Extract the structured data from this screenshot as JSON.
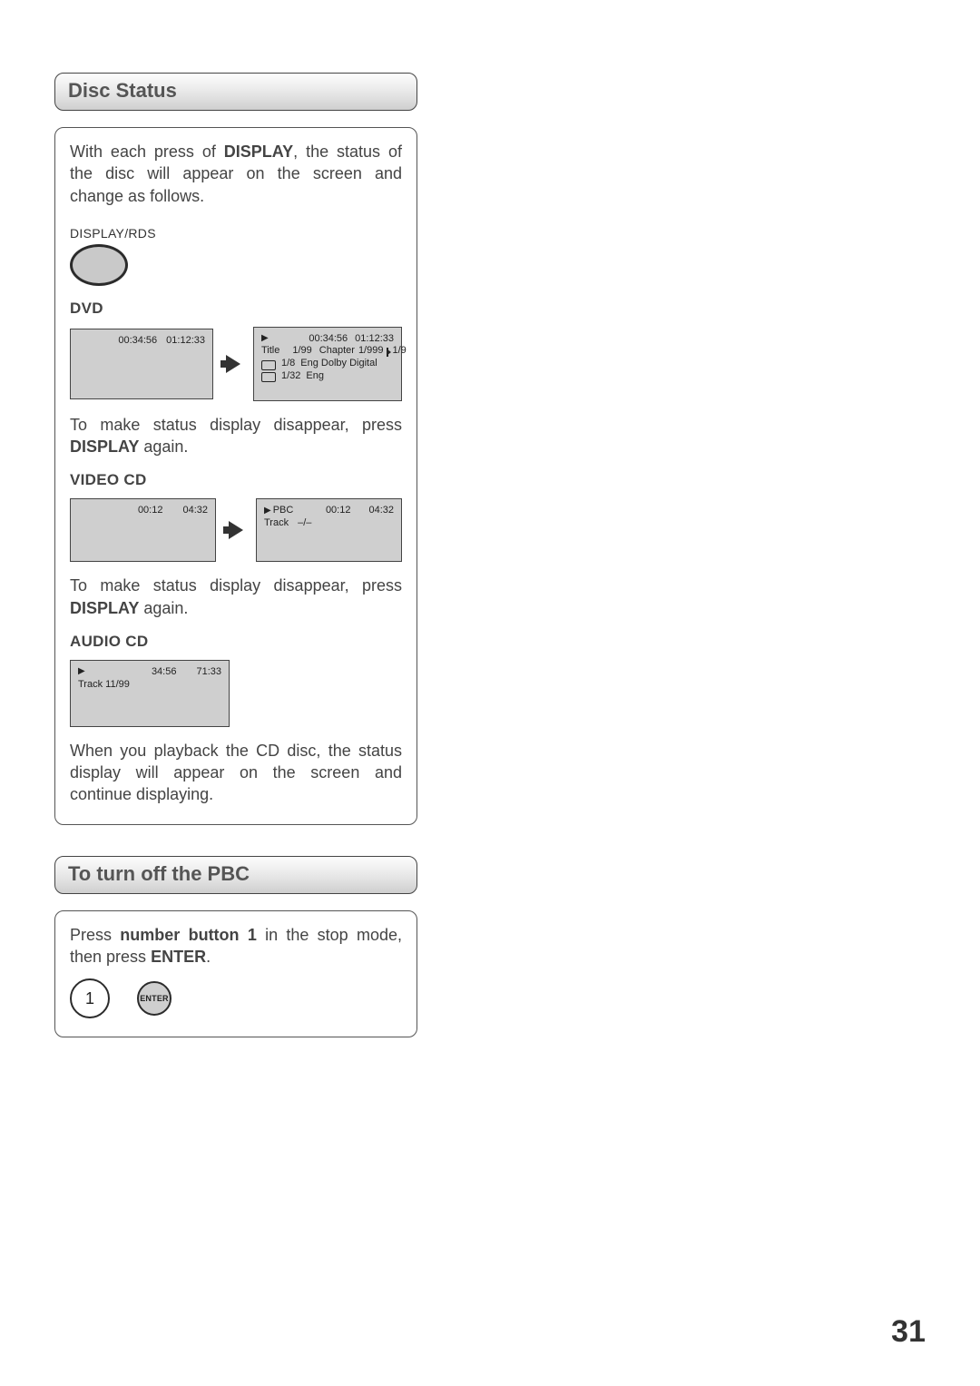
{
  "page_number": "31",
  "sections": {
    "disc_status": {
      "title": "Disc Status",
      "intro_pre": "With each press of ",
      "intro_bold": "DISPLAY",
      "intro_post": ", the status of the disc will appear on the screen and change as follows.",
      "button_label": "DISPLAY/RDS",
      "dvd": {
        "label": "DVD",
        "osd1": {
          "t1": "00:34:56",
          "t2": "01:12:33"
        },
        "osd2": {
          "t1": "00:34:56",
          "t2": "01:12:33",
          "title_label": "Title",
          "title_val": "1/99",
          "chapter_label": "Chapter",
          "chapter_val": "1/999",
          "angle_val": "1/9",
          "audio_val": "1/8",
          "audio_lang": "Eng Dolby Digital",
          "sub_val": "1/32",
          "sub_lang": "Eng"
        },
        "hint_pre": "To make status display disappear, press ",
        "hint_bold": "DISPLAY",
        "hint_post": " again."
      },
      "vcd": {
        "label": "VIDEO CD",
        "osd1": {
          "t1": "00:12",
          "t2": "04:32"
        },
        "osd2": {
          "pbc": "PBC",
          "t1": "00:12",
          "t2": "04:32",
          "track_label": "Track",
          "track_val": "–/–"
        },
        "hint_pre": "To make status display disappear, press ",
        "hint_bold": "DISPLAY",
        "hint_post": " again."
      },
      "acd": {
        "label": "AUDIO CD",
        "osd": {
          "t1": "34:56",
          "t2": "71:33",
          "track": "Track 11/99"
        },
        "hint": "When you playback the CD disc, the status display will appear on the screen and continue displaying."
      }
    },
    "pbc": {
      "title": "To turn off the PBC",
      "text_pre": "Press ",
      "text_b1": "number button 1",
      "text_mid": " in the stop mode, then press ",
      "text_b2": "ENTER",
      "text_post": ".",
      "btn1": "1",
      "btn_enter": "ENTER"
    }
  }
}
